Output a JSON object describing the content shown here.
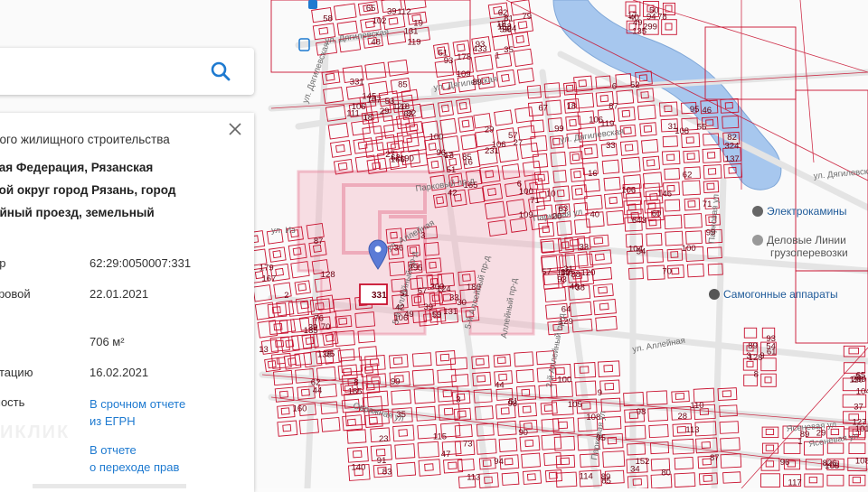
{
  "colors": {
    "parcel": "#c8102e",
    "highlight": "#f0a6b6",
    "water": "#a7c7ee",
    "link": "#1e7ad0",
    "marker": "#5b7bd6"
  },
  "search": {
    "placeholder": "",
    "icon": "search-icon"
  },
  "panel": {
    "close_icon": "close-icon",
    "title": "ного жилищного строительства",
    "address": [
      "кая Федерация, Рязанская",
      "кой округ город Рязань, город",
      "ейный проезд, земельный"
    ],
    "rows": [
      {
        "label": "ер",
        "value": "62:29:0050007:331"
      },
      {
        "label": "тровой",
        "value": "22.01.2021"
      },
      {
        "label": "",
        "value": "706 м²"
      },
      {
        "label": "атацию",
        "value": "16.02.2021"
      }
    ],
    "value_row": {
      "label": "мость",
      "link": [
        "В срочном отчете",
        "из ЕГРН"
      ]
    },
    "transfer_link": [
      "В отчете",
      "о переходе прав"
    ]
  },
  "watermark": "ИКЛИК",
  "map": {
    "pins": [
      {
        "name": "Электрокамины"
      },
      {
        "name": "Деловые Линии грузоперевозки"
      },
      {
        "name": "Самогонные аппараты"
      }
    ],
    "streets": [
      "ул. Дягилевская",
      "ул. Дягилевская",
      "ул. Дягилевская",
      "ул. Дягилевская",
      "Парковый пр-д",
      "Парковая ул",
      "ул. Аллейная",
      "5-й Аллейный пр-д",
      "ул. Аллейная",
      "Ясеневая ул",
      "Овражная ул",
      "Парковая ул",
      "ул. Дягилевская",
      "Ясеневая ул",
      "Парковая ул",
      "2-й Аллейный пр-д",
      "5-й Аллейный пр-д",
      "Аллейный пр-д",
      "ул. Из"
    ],
    "labels": [
      "119",
      "93",
      "85",
      "47",
      "27",
      "57",
      "87",
      "55",
      "54",
      "31",
      "13",
      "160",
      "99",
      "98",
      "95",
      "98",
      "53",
      "61",
      "826",
      "65",
      "81",
      "299",
      "295",
      "300",
      "39",
      "109",
      "166",
      "165",
      "6",
      "93",
      "119",
      "108",
      "100",
      "129",
      "128",
      "35",
      "140",
      "94",
      "108",
      "152",
      "92",
      "93",
      "108",
      "127",
      "153",
      "135",
      "106",
      "131",
      "112",
      "93",
      "111",
      "100",
      "106",
      "18",
      "40",
      "46",
      "146",
      "88",
      "70",
      "44",
      "91",
      "90",
      "105",
      "34",
      "107",
      "89",
      "108",
      "118",
      "24",
      "94",
      "42",
      "33",
      "131",
      "89",
      "120",
      "51",
      "109",
      "112",
      "106",
      "95",
      "99",
      "120",
      "135",
      "138",
      "115",
      "3",
      "114",
      "110",
      "118",
      "128",
      "117",
      "104",
      "79",
      "49",
      "51",
      "59",
      "102",
      "35",
      "106",
      "85",
      "29",
      "99",
      "33",
      "62",
      "104",
      "48",
      "87",
      "39",
      "83",
      "73",
      "85",
      "28",
      "29",
      "9",
      "96",
      "101",
      "96",
      "78",
      "36",
      "39",
      "48",
      "178",
      "331",
      "16",
      "100",
      "10",
      "16",
      "324",
      "60",
      "38",
      "167",
      "185",
      "35",
      "81",
      "100",
      "80",
      "190",
      "8",
      "89",
      "2",
      "62",
      "17",
      "49",
      "30",
      "65",
      "433",
      "145",
      "96",
      "57",
      "63",
      "6",
      "82",
      "70",
      "33",
      "179",
      "62",
      "47",
      "113",
      "89",
      "87",
      "62",
      "54",
      "29",
      "289",
      "57",
      "50",
      "67",
      "180",
      "58",
      "51",
      "18",
      "42",
      "231",
      "67",
      "106",
      "31",
      "643",
      "64",
      "2",
      "8",
      "23",
      "44",
      "9",
      "113",
      "27",
      "3",
      "1",
      "37",
      "18",
      "40",
      "3",
      "124",
      "19",
      "1",
      "62",
      "13",
      "71",
      "20",
      "52",
      "137",
      "71",
      "80",
      "76"
    ],
    "parcel_number": "331"
  }
}
